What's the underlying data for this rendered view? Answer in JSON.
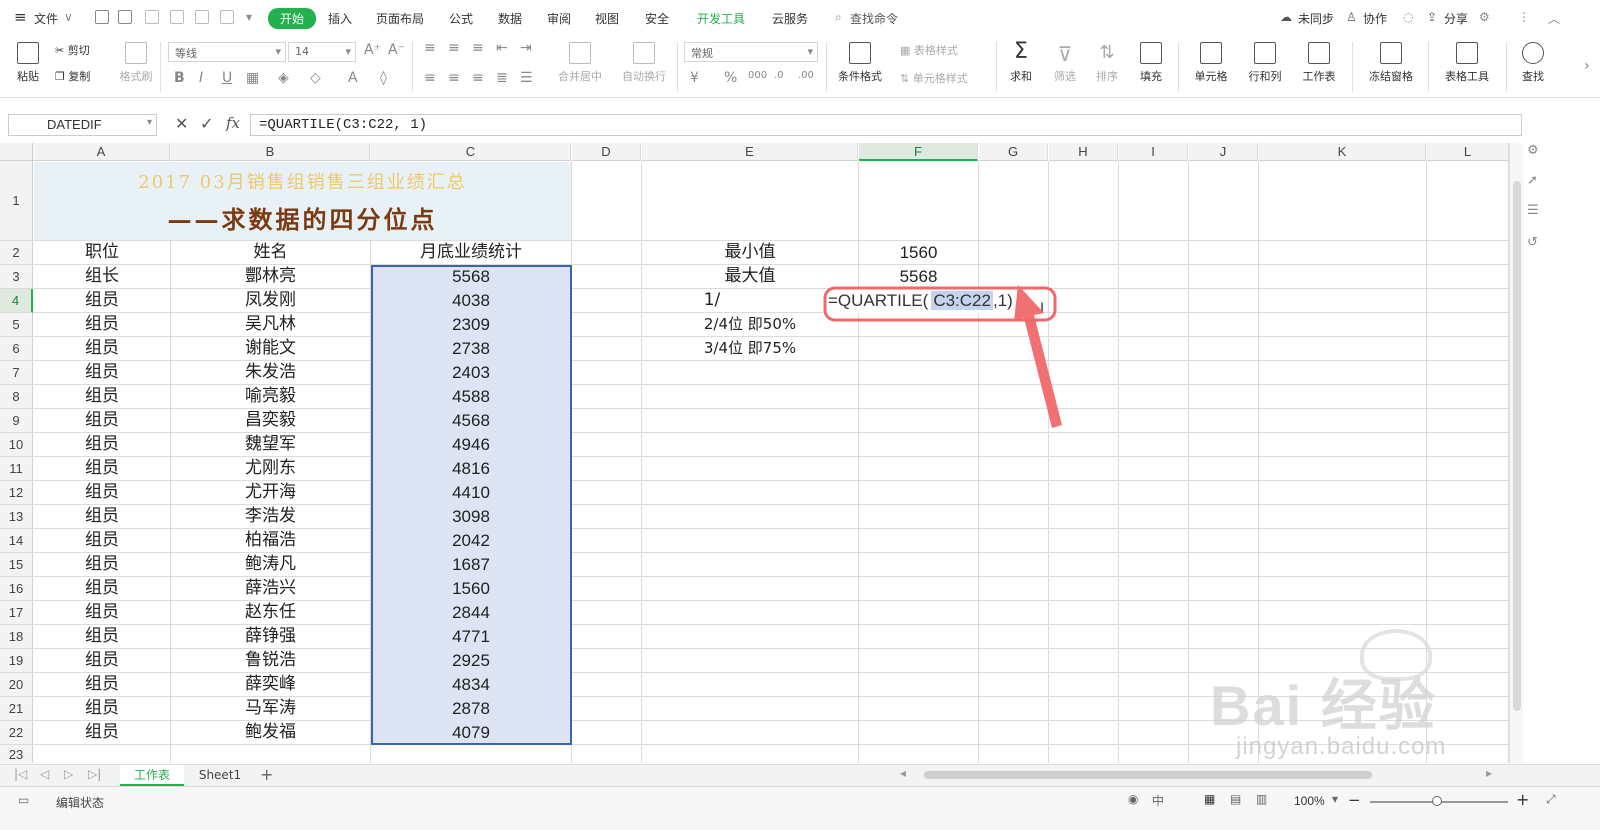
{
  "menu": {
    "file": "文件",
    "tabs": [
      "开始",
      "插入",
      "页面布局",
      "公式",
      "数据",
      "审阅",
      "视图",
      "安全",
      "开发工具",
      "云服务"
    ],
    "search": "查找命令",
    "right": {
      "sync": "未同步",
      "collab": "协作",
      "share": "分享"
    }
  },
  "ribbon": {
    "paste": "粘贴",
    "cut": "剪切",
    "copy": "复制",
    "format_painter": "格式刷",
    "font_name": "等线",
    "font_size": "14",
    "merge": "合并居中",
    "wrap": "自动换行",
    "number_format": "常规",
    "cond_format": "条件格式",
    "table_style": "表格样式",
    "cell_style": "单元格样式",
    "sum": "求和",
    "filter": "筛选",
    "sort": "排序",
    "fill": "填充",
    "cell": "单元格",
    "rowcol": "行和列",
    "sheet": "工作表",
    "freeze": "冻结窗格",
    "table_tools": "表格工具",
    "find": "查找"
  },
  "formula_bar": {
    "name_box": "DATEDIF",
    "formula": "=QUARTILE(C3:C22, 1)"
  },
  "columns": [
    "A",
    "B",
    "C",
    "D",
    "E",
    "F",
    "G",
    "H",
    "I",
    "J",
    "K",
    "L"
  ],
  "rows": [
    "1",
    "2",
    "3",
    "4",
    "5",
    "6",
    "7",
    "8",
    "9",
    "10",
    "11",
    "12",
    "13",
    "14",
    "15",
    "16",
    "17",
    "18",
    "19",
    "20",
    "21",
    "22",
    "23"
  ],
  "title": {
    "line1": "2017 03月销售组销售三组业绩汇总",
    "line2": "——求数据的四分位点"
  },
  "headers": {
    "a": "职位",
    "b": "姓名",
    "c": "月底业绩统计"
  },
  "table": [
    {
      "pos": "组长",
      "name": "酆林亮",
      "amt": "5568"
    },
    {
      "pos": "组员",
      "name": "凤发刚",
      "amt": "4038"
    },
    {
      "pos": "组员",
      "name": "吴凡林",
      "amt": "2309"
    },
    {
      "pos": "组员",
      "name": "谢能文",
      "amt": "2738"
    },
    {
      "pos": "组员",
      "name": "朱发浩",
      "amt": "2403"
    },
    {
      "pos": "组员",
      "name": "喻亮毅",
      "amt": "4588"
    },
    {
      "pos": "组员",
      "name": "昌奕毅",
      "amt": "4568"
    },
    {
      "pos": "组员",
      "name": "魏望军",
      "amt": "4946"
    },
    {
      "pos": "组员",
      "name": "尤刚东",
      "amt": "4816"
    },
    {
      "pos": "组员",
      "name": "尤开海",
      "amt": "4410"
    },
    {
      "pos": "组员",
      "name": "李浩发",
      "amt": "3098"
    },
    {
      "pos": "组员",
      "name": "柏福浩",
      "amt": "2042"
    },
    {
      "pos": "组员",
      "name": "鲍涛凡",
      "amt": "1687"
    },
    {
      "pos": "组员",
      "name": "薛浩兴",
      "amt": "1560"
    },
    {
      "pos": "组员",
      "name": "赵东任",
      "amt": "2844"
    },
    {
      "pos": "组员",
      "name": "薛铮强",
      "amt": "4771"
    },
    {
      "pos": "组员",
      "name": "鲁锐浩",
      "amt": "2925"
    },
    {
      "pos": "组员",
      "name": "薛奕峰",
      "amt": "4834"
    },
    {
      "pos": "组员",
      "name": "马军涛",
      "amt": "2878"
    },
    {
      "pos": "组员",
      "name": "鲍发福",
      "amt": "4079"
    }
  ],
  "stats": {
    "min_label": "最小值",
    "min_val": "1560",
    "max_label": "最大值",
    "max_val": "5568",
    "q1_label": "1/",
    "q2_label": "2/4位 即50%",
    "q3_label": "3/4位 即75%",
    "edit_prefix": "=QUARTILE(",
    "edit_ref": "C3:C22",
    "edit_suffix": ",1)"
  },
  "sheets": {
    "tab1": "工作表",
    "tab2": "Sheet1",
    "add": "+"
  },
  "status": {
    "mode": "编辑状态",
    "zoom": "100%"
  },
  "watermark": {
    "brand": "Bai 经验",
    "url": "jingyan.baidu.com"
  },
  "colors": {
    "accent": "#23b14d",
    "title_gold": "#f0c86a",
    "title_brown": "#7a3a12",
    "selection": "#dde4f3",
    "annotation": "#f0686a"
  }
}
